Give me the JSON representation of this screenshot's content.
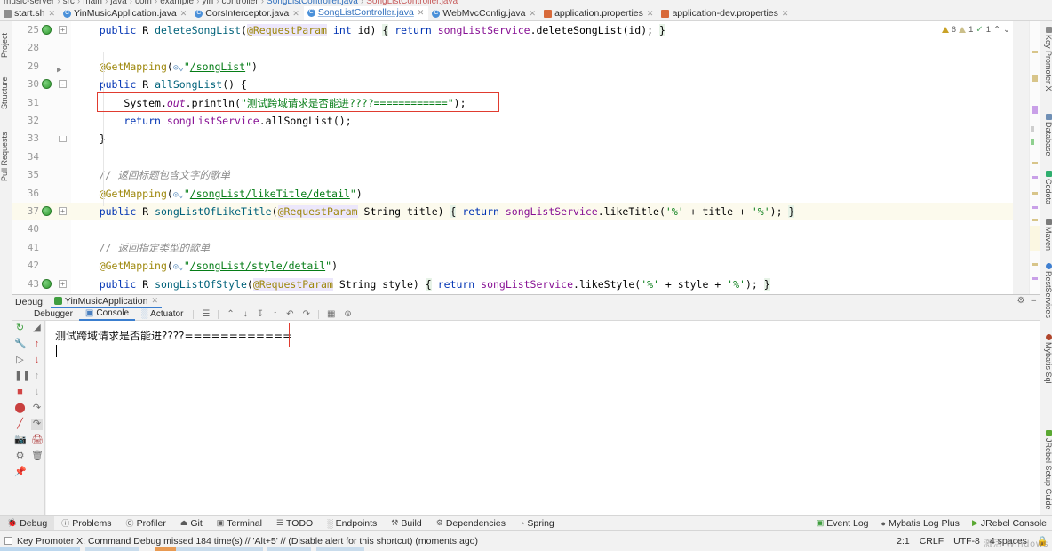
{
  "breadcrumb": {
    "segments": [
      "music-server",
      "src",
      "main",
      "java",
      "com",
      "example",
      "yin",
      "controller"
    ],
    "file_current": "SongListController.java",
    "file_next": "SongListController.java"
  },
  "tabs": [
    {
      "label": "start.sh",
      "icon": "shell-script-icon",
      "active": false,
      "closable": true
    },
    {
      "label": "YinMusicApplication.java",
      "icon": "java-class-icon",
      "active": false,
      "closable": true
    },
    {
      "label": "CorsInterceptor.java",
      "icon": "java-class-icon",
      "active": false,
      "closable": true
    },
    {
      "label": "SongListController.java",
      "icon": "java-class-icon",
      "active": true,
      "closable": true
    },
    {
      "label": "WebMvcConfig.java",
      "icon": "java-class-icon",
      "active": false,
      "closable": true
    },
    {
      "label": "application.properties",
      "icon": "properties-file-icon",
      "active": false,
      "closable": true
    },
    {
      "label": "application-dev.properties",
      "icon": "properties-file-icon",
      "active": false,
      "closable": true
    }
  ],
  "inspections": {
    "warning_count": "6",
    "weak_warning_count": "1",
    "ok_count": "1",
    "up_arrow": "⌃",
    "down_arrow": "⌄"
  },
  "left_stripe": [
    {
      "label": "Project"
    },
    {
      "label": "Structure"
    },
    {
      "label": "Pull Requests"
    }
  ],
  "right_stripe": [
    {
      "label": "Key Promoter X",
      "color": "#8a8a8a"
    },
    {
      "label": "Database",
      "color": "#6f8fb5"
    },
    {
      "label": "Codota",
      "color": "#2fae6e"
    },
    {
      "label": "Maven",
      "color": "#7a7a7a"
    },
    {
      "label": "RestServices",
      "color": "#3f7fd0"
    },
    {
      "label": "Mybatis Sql",
      "color": "#b0452b"
    },
    {
      "label": "JRebel Setup Guide",
      "color": "#5aa832"
    }
  ],
  "editor": {
    "lines": [
      {
        "num": "25",
        "gutter": "globe",
        "fold": "+",
        "indent": 1,
        "tokens": [
          {
            "t": "    ",
            "c": "plain"
          },
          {
            "t": "public",
            "c": "kw"
          },
          {
            "t": " ",
            "c": "plain"
          },
          {
            "t": "R",
            "c": "cls3"
          },
          {
            "t": " ",
            "c": "plain"
          },
          {
            "t": "deleteSongList",
            "c": "fn"
          },
          {
            "t": "(",
            "c": "plain"
          },
          {
            "t": "@RequestParam",
            "c": "annbg"
          },
          {
            "t": " ",
            "c": "plain"
          },
          {
            "t": "int",
            "c": "kw"
          },
          {
            "t": " ",
            "c": "plain"
          },
          {
            "t": "id",
            "c": "plain"
          },
          {
            "t": ")",
            "c": "plain"
          },
          {
            "t": " ",
            "c": "plain"
          },
          {
            "t": "{",
            "c": "brc"
          },
          {
            "t": " ",
            "c": "plain"
          },
          {
            "t": "return",
            "c": "kw"
          },
          {
            "t": " ",
            "c": "plain"
          },
          {
            "t": "songListService",
            "c": "var"
          },
          {
            "t": ".",
            "c": "plain"
          },
          {
            "t": "deleteSongList",
            "c": "cls3"
          },
          {
            "t": "(",
            "c": "plain"
          },
          {
            "t": "id",
            "c": "plain"
          },
          {
            "t": ")",
            "c": "plain"
          },
          {
            "t": ";",
            "c": "plain"
          },
          {
            "t": " ",
            "c": "plain"
          },
          {
            "t": "}",
            "c": "brc"
          }
        ]
      },
      {
        "num": "28",
        "gutter": "",
        "fold": "",
        "indent": 0,
        "tokens": []
      },
      {
        "num": "29",
        "gutter": "",
        "fold": "run",
        "indent": 1,
        "tokens": [
          {
            "t": "    ",
            "c": "plain"
          },
          {
            "t": "@GetMapping",
            "c": "ann"
          },
          {
            "t": "(",
            "c": "plain"
          },
          {
            "t": "⊙⌄",
            "c": "mapico"
          },
          {
            "t": "\"",
            "c": "str"
          },
          {
            "t": "/songList",
            "c": "urlu"
          },
          {
            "t": "\"",
            "c": "str"
          },
          {
            "t": ")",
            "c": "plain"
          }
        ]
      },
      {
        "num": "30",
        "gutter": "globe",
        "fold": "-",
        "indent": 1,
        "tokens": [
          {
            "t": "    ",
            "c": "plain"
          },
          {
            "t": "public",
            "c": "kw"
          },
          {
            "t": " ",
            "c": "plain"
          },
          {
            "t": "R",
            "c": "cls3"
          },
          {
            "t": " ",
            "c": "plain"
          },
          {
            "t": "allSongList",
            "c": "fn"
          },
          {
            "t": "()",
            "c": "plain"
          },
          {
            "t": " ",
            "c": "plain"
          },
          {
            "t": "{",
            "c": "plain"
          }
        ]
      },
      {
        "num": "31",
        "gutter": "",
        "fold": "",
        "indent": 2,
        "tokens": [
          {
            "t": "        ",
            "c": "plain"
          },
          {
            "t": "System",
            "c": "cls3"
          },
          {
            "t": ".",
            "c": "plain"
          },
          {
            "t": "out",
            "c": "fld"
          },
          {
            "t": ".",
            "c": "plain"
          },
          {
            "t": "println",
            "c": "cls3"
          },
          {
            "t": "(",
            "c": "plain"
          },
          {
            "t": "\"测试跨域请求是否能进????============\"",
            "c": "str"
          },
          {
            "t": ")",
            "c": "plain"
          },
          {
            "t": ";",
            "c": "plain"
          }
        ]
      },
      {
        "num": "32",
        "gutter": "",
        "fold": "",
        "indent": 2,
        "tokens": [
          {
            "t": "        ",
            "c": "plain"
          },
          {
            "t": "return",
            "c": "kw"
          },
          {
            "t": " ",
            "c": "plain"
          },
          {
            "t": "songListService",
            "c": "var"
          },
          {
            "t": ".",
            "c": "plain"
          },
          {
            "t": "allSongList",
            "c": "cls3"
          },
          {
            "t": "()",
            "c": "plain"
          },
          {
            "t": ";",
            "c": "plain"
          }
        ]
      },
      {
        "num": "33",
        "gutter": "",
        "fold": "endfold",
        "indent": 1,
        "tokens": [
          {
            "t": "    ",
            "c": "plain"
          },
          {
            "t": "}",
            "c": "plain"
          }
        ]
      },
      {
        "num": "34",
        "gutter": "",
        "fold": "",
        "indent": 0,
        "tokens": []
      },
      {
        "num": "35",
        "gutter": "",
        "fold": "",
        "indent": 1,
        "tokens": [
          {
            "t": "    ",
            "c": "plain"
          },
          {
            "t": "// 返回标题包含文字的歌单",
            "c": "com"
          }
        ]
      },
      {
        "num": "36",
        "gutter": "",
        "fold": "",
        "indent": 1,
        "tokens": [
          {
            "t": "    ",
            "c": "plain"
          },
          {
            "t": "@GetMapping",
            "c": "ann"
          },
          {
            "t": "(",
            "c": "plain"
          },
          {
            "t": "⊙⌄",
            "c": "mapico"
          },
          {
            "t": "\"",
            "c": "str"
          },
          {
            "t": "/songList/likeTitle/detail",
            "c": "urlu"
          },
          {
            "t": "\"",
            "c": "str"
          },
          {
            "t": ")",
            "c": "plain"
          }
        ]
      },
      {
        "num": "37",
        "gutter": "globe",
        "fold": "+",
        "indent": 1,
        "highlight": true,
        "tokens": [
          {
            "t": "    ",
            "c": "plain"
          },
          {
            "t": "public",
            "c": "kw"
          },
          {
            "t": " ",
            "c": "plain"
          },
          {
            "t": "R",
            "c": "cls3"
          },
          {
            "t": " ",
            "c": "plain"
          },
          {
            "t": "songListOfLikeTitle",
            "c": "fn"
          },
          {
            "t": "(",
            "c": "plain"
          },
          {
            "t": "@RequestParam",
            "c": "annbg"
          },
          {
            "t": " ",
            "c": "plain"
          },
          {
            "t": "String",
            "c": "cls3"
          },
          {
            "t": " ",
            "c": "plain"
          },
          {
            "t": "title",
            "c": "plain"
          },
          {
            "t": ")",
            "c": "plain"
          },
          {
            "t": " ",
            "c": "plain"
          },
          {
            "t": "{",
            "c": "brc"
          },
          {
            "t": " ",
            "c": "plain"
          },
          {
            "t": "return",
            "c": "kw"
          },
          {
            "t": " ",
            "c": "plain"
          },
          {
            "t": "songListService",
            "c": "var"
          },
          {
            "t": ".",
            "c": "plain"
          },
          {
            "t": "likeTitle",
            "c": "cls3"
          },
          {
            "t": "(",
            "c": "plain"
          },
          {
            "t": "'%'",
            "c": "str"
          },
          {
            "t": " + ",
            "c": "plain"
          },
          {
            "t": "title",
            "c": "plain"
          },
          {
            "t": " + ",
            "c": "plain"
          },
          {
            "t": "'%'",
            "c": "str"
          },
          {
            "t": ")",
            "c": "plain"
          },
          {
            "t": ";",
            "c": "plain"
          },
          {
            "t": " ",
            "c": "plain"
          },
          {
            "t": "}",
            "c": "brc"
          }
        ]
      },
      {
        "num": "40",
        "gutter": "",
        "fold": "",
        "indent": 0,
        "tokens": []
      },
      {
        "num": "41",
        "gutter": "",
        "fold": "",
        "indent": 1,
        "tokens": [
          {
            "t": "    ",
            "c": "plain"
          },
          {
            "t": "// 返回指定类型的歌单",
            "c": "com"
          }
        ]
      },
      {
        "num": "42",
        "gutter": "",
        "fold": "",
        "indent": 1,
        "tokens": [
          {
            "t": "    ",
            "c": "plain"
          },
          {
            "t": "@GetMapping",
            "c": "ann"
          },
          {
            "t": "(",
            "c": "plain"
          },
          {
            "t": "⊙⌄",
            "c": "mapico"
          },
          {
            "t": "\"",
            "c": "str"
          },
          {
            "t": "/songList/style/detail",
            "c": "urlu"
          },
          {
            "t": "\"",
            "c": "str"
          },
          {
            "t": ")",
            "c": "plain"
          }
        ]
      },
      {
        "num": "43",
        "gutter": "globe",
        "fold": "+",
        "indent": 1,
        "tokens": [
          {
            "t": "    ",
            "c": "plain"
          },
          {
            "t": "public",
            "c": "kw"
          },
          {
            "t": " ",
            "c": "plain"
          },
          {
            "t": "R",
            "c": "cls3"
          },
          {
            "t": " ",
            "c": "plain"
          },
          {
            "t": "songListOfStyle",
            "c": "fn"
          },
          {
            "t": "(",
            "c": "plain"
          },
          {
            "t": "@RequestParam",
            "c": "annbg"
          },
          {
            "t": " ",
            "c": "plain"
          },
          {
            "t": "String",
            "c": "cls3"
          },
          {
            "t": " ",
            "c": "plain"
          },
          {
            "t": "style",
            "c": "plain"
          },
          {
            "t": ")",
            "c": "plain"
          },
          {
            "t": " ",
            "c": "plain"
          },
          {
            "t": "{",
            "c": "brc"
          },
          {
            "t": " ",
            "c": "plain"
          },
          {
            "t": "return",
            "c": "kw"
          },
          {
            "t": " ",
            "c": "plain"
          },
          {
            "t": "songListService",
            "c": "var"
          },
          {
            "t": ".",
            "c": "plain"
          },
          {
            "t": "likeStyle",
            "c": "cls3"
          },
          {
            "t": "(",
            "c": "plain"
          },
          {
            "t": "'%'",
            "c": "str"
          },
          {
            "t": " + ",
            "c": "plain"
          },
          {
            "t": "style",
            "c": "plain"
          },
          {
            "t": " + ",
            "c": "plain"
          },
          {
            "t": "'%'",
            "c": "str"
          },
          {
            "t": ")",
            "c": "plain"
          },
          {
            "t": ";",
            "c": "plain"
          },
          {
            "t": " ",
            "c": "plain"
          },
          {
            "t": "}",
            "c": "brc"
          }
        ]
      }
    ]
  },
  "debug_panel": {
    "title": "Debug:",
    "run_config": "YinMusicApplication",
    "tabs": [
      {
        "label": "Debugger",
        "active": false
      },
      {
        "label": "Console",
        "active": true
      },
      {
        "label": "Actuator",
        "active": false
      }
    ],
    "console_output": "测试跨域请求是否能进????============"
  },
  "bottom_bar": {
    "items": [
      {
        "label": "Debug",
        "icon": "debug-icon",
        "active": true
      },
      {
        "label": "Problems",
        "icon": "problems-icon",
        "active": false
      },
      {
        "label": "Profiler",
        "icon": "profiler-icon",
        "active": false
      },
      {
        "label": "Git",
        "icon": "git-icon",
        "active": false
      },
      {
        "label": "Terminal",
        "icon": "terminal-icon",
        "active": false
      },
      {
        "label": "TODO",
        "icon": "todo-icon",
        "active": false
      },
      {
        "label": "Endpoints",
        "icon": "endpoints-icon",
        "active": false
      },
      {
        "label": "Build",
        "icon": "build-icon",
        "active": false
      },
      {
        "label": "Dependencies",
        "icon": "dependencies-icon",
        "active": false
      },
      {
        "label": "Spring",
        "icon": "spring-icon",
        "active": false
      }
    ],
    "right_items": [
      {
        "label": "Event Log",
        "icon": "event-log-icon"
      },
      {
        "label": "Mybatis Log Plus",
        "icon": "mybatis-icon"
      },
      {
        "label": "JRebel Console",
        "icon": "jrebel-icon"
      }
    ]
  },
  "status_bar": {
    "message": "Key Promoter X: Command Debug missed 184 time(s) // 'Alt+5' // (Disable alert for this shortcut) (moments ago)",
    "caret_position": "2:1",
    "line_separator": "CRLF",
    "encoding": "UTF-8",
    "indent": "4 spaces",
    "watermark": "激活 Windows"
  }
}
